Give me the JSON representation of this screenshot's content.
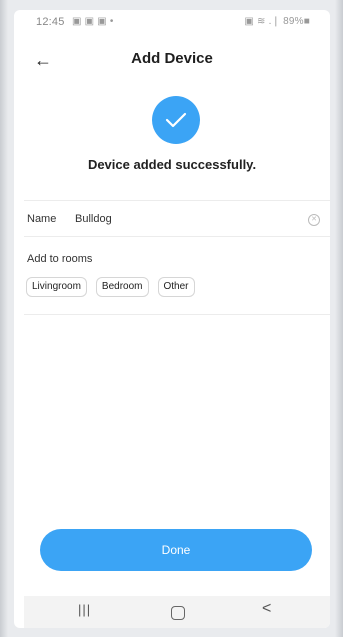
{
  "status_bar": {
    "time": "12:45",
    "notifications": "▣ ▣ ▣ •",
    "system": "▣ ≋ .❘ 89%■"
  },
  "header": {
    "title": "Add Device",
    "back_icon": "←"
  },
  "success": {
    "message": "Device added successfully."
  },
  "name_field": {
    "label": "Name",
    "value": "Bulldog",
    "clear_icon": "✕"
  },
  "rooms": {
    "label": "Add to rooms",
    "options": [
      "Livingroom",
      "Bedroom",
      "Other"
    ]
  },
  "actions": {
    "done_label": "Done"
  },
  "nav_bar": {
    "recent_icon": "|||",
    "back_icon": "<"
  },
  "colors": {
    "accent": "#3ba4f5",
    "text": "#222222",
    "divider": "#ececec"
  }
}
